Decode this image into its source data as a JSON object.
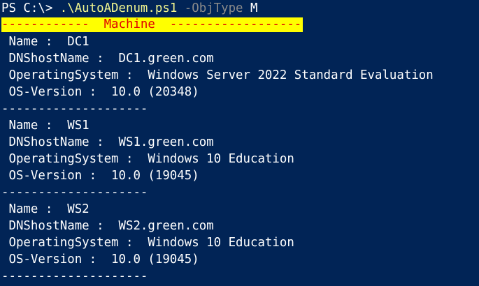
{
  "prompt": {
    "prefix": "PS C:\\> ",
    "command": ".\\AutoADenum.ps1",
    "parameter": " -ObjType",
    "argument": " M"
  },
  "banner": "------------  Machine  ------------------",
  "separator": "--------------------",
  "machines": [
    {
      "name": " Name :  DC1",
      "dns": " DNShostName :  DC1.green.com",
      "os": " OperatingSystem :  Windows Server 2022 Standard Evaluation",
      "version": " OS-Version :  10.0 (20348)"
    },
    {
      "name": " Name :  WS1",
      "dns": " DNShostName :  WS1.green.com",
      "os": " OperatingSystem :  Windows 10 Education",
      "version": " OS-Version :  10.0 (19045)"
    },
    {
      "name": " Name :  WS2",
      "dns": " DNShostName :  WS2.green.com",
      "os": " OperatingSystem :  Windows 10 Education",
      "version": " OS-Version :  10.0 (19045)"
    }
  ],
  "colors": {
    "background": "#012456",
    "command": "#f1f58f",
    "parameter": "#8a8a8a",
    "banner_bg": "#ffff00",
    "banner_fg": "#e00000"
  }
}
